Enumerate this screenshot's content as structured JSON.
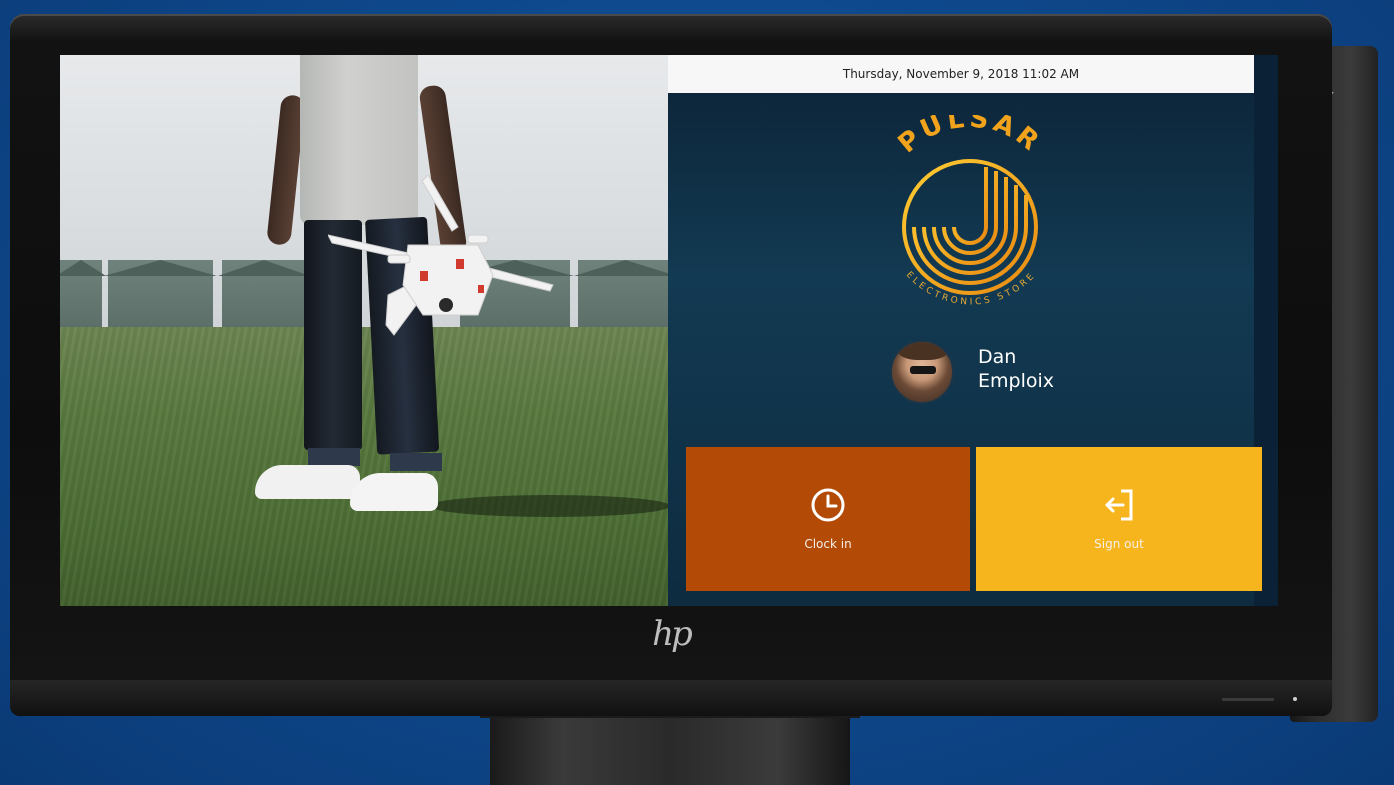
{
  "screen": {
    "datetime": "Thursday, November 9, 2018 11:02 AM"
  },
  "brand": {
    "name": "PULSAR",
    "tagline": "ELECTRONICS STORE",
    "colors": {
      "primary": "#f5a623",
      "accent": "#e8581c"
    }
  },
  "user": {
    "first_name": "Dan",
    "last_name": "Emploix"
  },
  "actions": [
    {
      "label": "Clock in",
      "icon": "clock-icon",
      "color": "#b34a06"
    },
    {
      "label": "Sign out",
      "icon": "sign-out-icon",
      "color": "#f7b51d"
    }
  ],
  "device": {
    "logo": "hp",
    "side_control_icon": "chevron-down-icon"
  },
  "theme": {
    "page_background": "#0f4a8f",
    "kiosk_background": "#123a52",
    "datebar_background": "#f7f7f7"
  }
}
